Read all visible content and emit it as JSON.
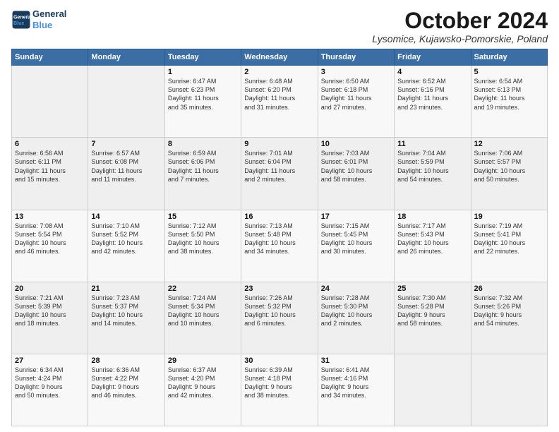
{
  "header": {
    "logo_line1": "General",
    "logo_line2": "Blue",
    "month": "October 2024",
    "location": "Lysomice, Kujawsko-Pomorskie, Poland"
  },
  "days_of_week": [
    "Sunday",
    "Monday",
    "Tuesday",
    "Wednesday",
    "Thursday",
    "Friday",
    "Saturday"
  ],
  "weeks": [
    [
      {
        "num": "",
        "info": ""
      },
      {
        "num": "",
        "info": ""
      },
      {
        "num": "1",
        "info": "Sunrise: 6:47 AM\nSunset: 6:23 PM\nDaylight: 11 hours\nand 35 minutes."
      },
      {
        "num": "2",
        "info": "Sunrise: 6:48 AM\nSunset: 6:20 PM\nDaylight: 11 hours\nand 31 minutes."
      },
      {
        "num": "3",
        "info": "Sunrise: 6:50 AM\nSunset: 6:18 PM\nDaylight: 11 hours\nand 27 minutes."
      },
      {
        "num": "4",
        "info": "Sunrise: 6:52 AM\nSunset: 6:16 PM\nDaylight: 11 hours\nand 23 minutes."
      },
      {
        "num": "5",
        "info": "Sunrise: 6:54 AM\nSunset: 6:13 PM\nDaylight: 11 hours\nand 19 minutes."
      }
    ],
    [
      {
        "num": "6",
        "info": "Sunrise: 6:56 AM\nSunset: 6:11 PM\nDaylight: 11 hours\nand 15 minutes."
      },
      {
        "num": "7",
        "info": "Sunrise: 6:57 AM\nSunset: 6:08 PM\nDaylight: 11 hours\nand 11 minutes."
      },
      {
        "num": "8",
        "info": "Sunrise: 6:59 AM\nSunset: 6:06 PM\nDaylight: 11 hours\nand 7 minutes."
      },
      {
        "num": "9",
        "info": "Sunrise: 7:01 AM\nSunset: 6:04 PM\nDaylight: 11 hours\nand 2 minutes."
      },
      {
        "num": "10",
        "info": "Sunrise: 7:03 AM\nSunset: 6:01 PM\nDaylight: 10 hours\nand 58 minutes."
      },
      {
        "num": "11",
        "info": "Sunrise: 7:04 AM\nSunset: 5:59 PM\nDaylight: 10 hours\nand 54 minutes."
      },
      {
        "num": "12",
        "info": "Sunrise: 7:06 AM\nSunset: 5:57 PM\nDaylight: 10 hours\nand 50 minutes."
      }
    ],
    [
      {
        "num": "13",
        "info": "Sunrise: 7:08 AM\nSunset: 5:54 PM\nDaylight: 10 hours\nand 46 minutes."
      },
      {
        "num": "14",
        "info": "Sunrise: 7:10 AM\nSunset: 5:52 PM\nDaylight: 10 hours\nand 42 minutes."
      },
      {
        "num": "15",
        "info": "Sunrise: 7:12 AM\nSunset: 5:50 PM\nDaylight: 10 hours\nand 38 minutes."
      },
      {
        "num": "16",
        "info": "Sunrise: 7:13 AM\nSunset: 5:48 PM\nDaylight: 10 hours\nand 34 minutes."
      },
      {
        "num": "17",
        "info": "Sunrise: 7:15 AM\nSunset: 5:45 PM\nDaylight: 10 hours\nand 30 minutes."
      },
      {
        "num": "18",
        "info": "Sunrise: 7:17 AM\nSunset: 5:43 PM\nDaylight: 10 hours\nand 26 minutes."
      },
      {
        "num": "19",
        "info": "Sunrise: 7:19 AM\nSunset: 5:41 PM\nDaylight: 10 hours\nand 22 minutes."
      }
    ],
    [
      {
        "num": "20",
        "info": "Sunrise: 7:21 AM\nSunset: 5:39 PM\nDaylight: 10 hours\nand 18 minutes."
      },
      {
        "num": "21",
        "info": "Sunrise: 7:23 AM\nSunset: 5:37 PM\nDaylight: 10 hours\nand 14 minutes."
      },
      {
        "num": "22",
        "info": "Sunrise: 7:24 AM\nSunset: 5:34 PM\nDaylight: 10 hours\nand 10 minutes."
      },
      {
        "num": "23",
        "info": "Sunrise: 7:26 AM\nSunset: 5:32 PM\nDaylight: 10 hours\nand 6 minutes."
      },
      {
        "num": "24",
        "info": "Sunrise: 7:28 AM\nSunset: 5:30 PM\nDaylight: 10 hours\nand 2 minutes."
      },
      {
        "num": "25",
        "info": "Sunrise: 7:30 AM\nSunset: 5:28 PM\nDaylight: 9 hours\nand 58 minutes."
      },
      {
        "num": "26",
        "info": "Sunrise: 7:32 AM\nSunset: 5:26 PM\nDaylight: 9 hours\nand 54 minutes."
      }
    ],
    [
      {
        "num": "27",
        "info": "Sunrise: 6:34 AM\nSunset: 4:24 PM\nDaylight: 9 hours\nand 50 minutes."
      },
      {
        "num": "28",
        "info": "Sunrise: 6:36 AM\nSunset: 4:22 PM\nDaylight: 9 hours\nand 46 minutes."
      },
      {
        "num": "29",
        "info": "Sunrise: 6:37 AM\nSunset: 4:20 PM\nDaylight: 9 hours\nand 42 minutes."
      },
      {
        "num": "30",
        "info": "Sunrise: 6:39 AM\nSunset: 4:18 PM\nDaylight: 9 hours\nand 38 minutes."
      },
      {
        "num": "31",
        "info": "Sunrise: 6:41 AM\nSunset: 4:16 PM\nDaylight: 9 hours\nand 34 minutes."
      },
      {
        "num": "",
        "info": ""
      },
      {
        "num": "",
        "info": ""
      }
    ]
  ]
}
